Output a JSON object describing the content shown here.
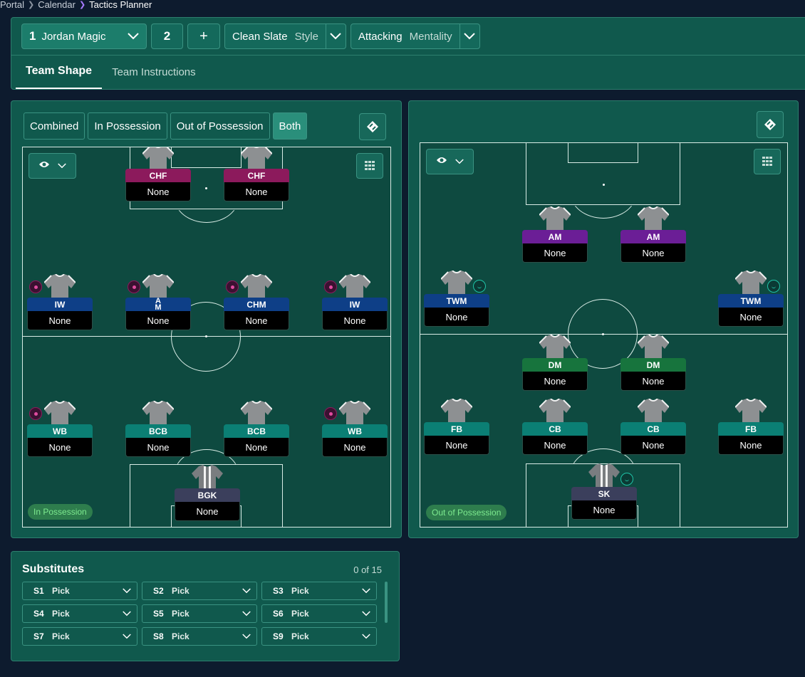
{
  "breadcrumb": {
    "items": [
      "Portal",
      "Calendar"
    ],
    "current": "Tactics Planner"
  },
  "toolbar": {
    "team_number": "1",
    "team_name": "Jordan Magic",
    "slot_2": "2",
    "add": "+",
    "style_value": "Clean Slate",
    "style_label": "Style",
    "mentality_value": "Attacking",
    "mentality_label": "Mentality"
  },
  "tabs": [
    "Team Shape",
    "Team Instructions"
  ],
  "view_modes": [
    "Combined",
    "In Possession",
    "Out of Possession",
    "Both"
  ],
  "left_pitch": {
    "phase": "In Possession",
    "players": [
      {
        "role": "CHF",
        "name": "None",
        "color": "magenta"
      },
      {
        "role": "CHF",
        "name": "None",
        "color": "magenta"
      },
      {
        "role": "IW",
        "name": "None",
        "color": "blue"
      },
      {
        "role": "A\nM",
        "name": "None",
        "color": "blue"
      },
      {
        "role": "CHM",
        "name": "None",
        "color": "blue"
      },
      {
        "role": "IW",
        "name": "None",
        "color": "blue"
      },
      {
        "role": "WB",
        "name": "None",
        "color": "teal"
      },
      {
        "role": "BCB",
        "name": "None",
        "color": "teal"
      },
      {
        "role": "BCB",
        "name": "None",
        "color": "teal"
      },
      {
        "role": "WB",
        "name": "None",
        "color": "teal"
      },
      {
        "role": "BGK",
        "name": "None",
        "color": "slate"
      }
    ]
  },
  "right_pitch": {
    "phase": "Out of Possession",
    "players": [
      {
        "role": "AM",
        "name": "None",
        "color": "purple"
      },
      {
        "role": "AM",
        "name": "None",
        "color": "purple"
      },
      {
        "role": "TWM",
        "name": "None",
        "color": "blue"
      },
      {
        "role": "TWM",
        "name": "None",
        "color": "blue"
      },
      {
        "role": "DM",
        "name": "None",
        "color": "green"
      },
      {
        "role": "DM",
        "name": "None",
        "color": "green"
      },
      {
        "role": "FB",
        "name": "None",
        "color": "teal"
      },
      {
        "role": "CB",
        "name": "None",
        "color": "teal"
      },
      {
        "role": "CB",
        "name": "None",
        "color": "teal"
      },
      {
        "role": "FB",
        "name": "None",
        "color": "teal"
      },
      {
        "role": "SK",
        "name": "None",
        "color": "slate"
      }
    ]
  },
  "substitutes": {
    "title": "Substitutes",
    "count": "0 of 15",
    "slots": [
      {
        "slot": "S1",
        "value": "Pick"
      },
      {
        "slot": "S2",
        "value": "Pick"
      },
      {
        "slot": "S3",
        "value": "Pick"
      },
      {
        "slot": "S4",
        "value": "Pick"
      },
      {
        "slot": "S5",
        "value": "Pick"
      },
      {
        "slot": "S6",
        "value": "Pick"
      },
      {
        "slot": "S7",
        "value": "Pick"
      },
      {
        "slot": "S8",
        "value": "Pick"
      },
      {
        "slot": "S9",
        "value": "Pick"
      }
    ]
  },
  "colors": {
    "panel": "#10594d",
    "background": "#0d1b2e",
    "pitch": "#0e4a40",
    "accent_purple": "#a77bff"
  }
}
